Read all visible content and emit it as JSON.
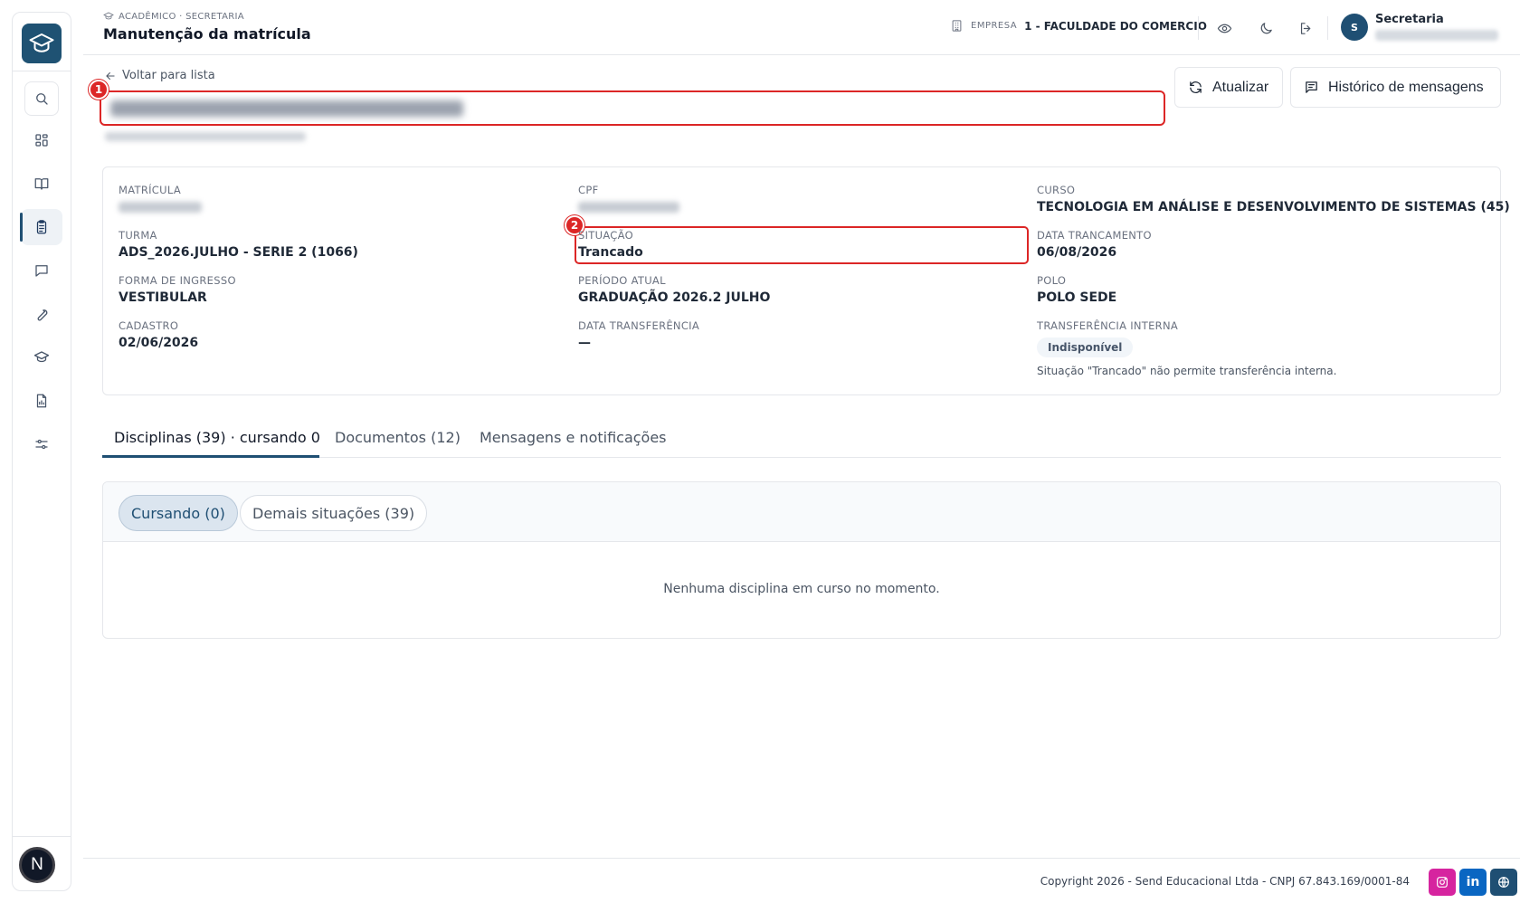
{
  "sidebar": {
    "items": [
      "search-icon",
      "dashboard-icon",
      "book-icon",
      "clipboard-icon",
      "message-icon",
      "wrench-icon",
      "graduation-cap-icon",
      "file-chart-icon",
      "sliders-icon"
    ],
    "active_index": 3,
    "avatar_letter": "N"
  },
  "header": {
    "breadcrumb": "ACADÊMICO · SECRETARIA",
    "title": "Manutenção da matrícula",
    "company_label": "EMPRESA",
    "company_name": "1 - FACULDADE DO COMERCIO",
    "user_initial": "S",
    "user_name": "Secretaria"
  },
  "main": {
    "back_link": "Voltar para lista",
    "markers": [
      "1",
      "2"
    ],
    "buttons": {
      "refresh": "Atualizar",
      "history": "Histórico de mensagens"
    }
  },
  "info": {
    "matricula_label": "MATRÍCULA",
    "cpf_label": "CPF",
    "curso_label": "CURSO",
    "curso_value": "TECNOLOGIA EM ANÁLISE E DESENVOLVIMENTO DE SISTEMAS (45)",
    "turma_label": "TURMA",
    "turma_value": "ADS_2026.JULHO - SERIE 2 (1066)",
    "situacao_label": "SITUAÇÃO",
    "situacao_value": "Trancado",
    "data_trancamento_label": "DATA TRANCAMENTO",
    "data_trancamento_value": "06/08/2026",
    "forma_label": "FORMA DE INGRESSO",
    "forma_value": "VESTIBULAR",
    "periodo_label": "PERÍODO ATUAL",
    "periodo_value": "GRADUAÇÃO 2026.2 JULHO",
    "polo_label": "POLO",
    "polo_value": "POLO SEDE",
    "cadastro_label": "CADASTRO",
    "cadastro_value": "02/06/2026",
    "data_transf_label": "DATA TRANSFERÊNCIA",
    "data_transf_value": "—",
    "transf_interna_label": "TRANSFERÊNCIA INTERNA",
    "transf_interna_badge": "Indisponível",
    "transf_interna_note": "Situação \"Trancado\" não permite transferência interna."
  },
  "tabs": {
    "disciplinas": "Disciplinas (39) · cursando 0",
    "documentos": "Documentos (12)",
    "mensagens": "Mensagens e notificações",
    "active": "disciplinas"
  },
  "panel": {
    "filter_cursando": "Cursando (0)",
    "filter_demais": "Demais situações (39)",
    "empty_message": "Nenhuma disciplina em curso no momento."
  },
  "footer": {
    "copyright": "Copyright 2026 - Send Educacional Ltda - CNPJ 67.843.169/0001-84",
    "social": [
      "instagram-icon",
      "linkedin-icon",
      "globe-icon"
    ],
    "linkedin_text": "in"
  },
  "colors": {
    "brand": "#1f4f73",
    "marker_red": "#dc2626",
    "instagram": "#d6249f",
    "linkedin": "#0a66c2",
    "globe": "#1f4f73"
  }
}
